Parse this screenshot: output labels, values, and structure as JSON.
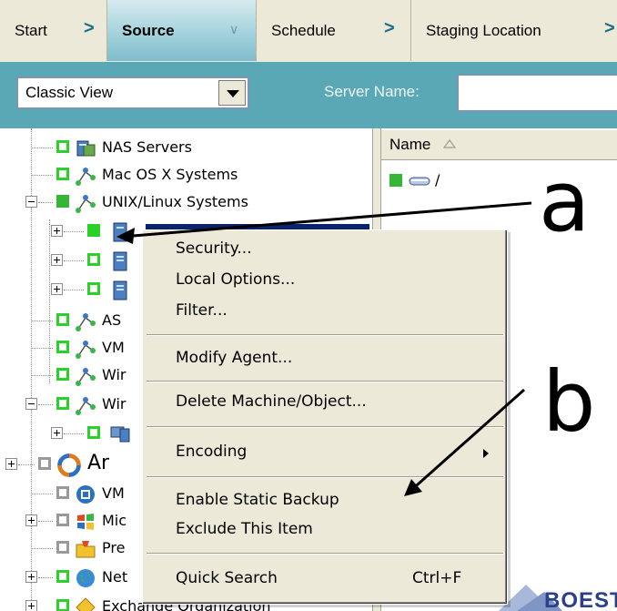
{
  "wizard_tabs": [
    {
      "label": "Start"
    },
    {
      "label": "Source"
    },
    {
      "label": "Schedule"
    },
    {
      "label": "Staging Location"
    }
  ],
  "view_select": {
    "value": "Classic View"
  },
  "server_name": {
    "label": "Server Name:",
    "value": ""
  },
  "tree": {
    "items": [
      {
        "label": "NAS Servers",
        "icon": "nas-server-icon"
      },
      {
        "label": "Mac OS X Systems",
        "icon": "network-icon"
      },
      {
        "label": "UNIX/Linux Systems",
        "icon": "network-icon"
      },
      {
        "label": "",
        "icon": "server-icon"
      },
      {
        "label": "",
        "icon": "server-icon"
      },
      {
        "label": "",
        "icon": "server-icon"
      },
      {
        "label": "AS",
        "icon": "network-icon"
      },
      {
        "label": "VM",
        "icon": "network-icon"
      },
      {
        "label": "Wir",
        "icon": "network-icon"
      },
      {
        "label": "Wir",
        "icon": "network-icon"
      },
      {
        "label": "",
        "icon": "computer-icon"
      },
      {
        "label": "Ar",
        "icon": "sync-icon"
      },
      {
        "label": "VM",
        "icon": "vm-icon"
      },
      {
        "label": "Mic",
        "icon": "microsoft-icon"
      },
      {
        "label": "Pre",
        "icon": "folder-icon"
      },
      {
        "label": "Net",
        "icon": "globe-icon"
      },
      {
        "label": "Exchange Organization",
        "icon": "exchange-icon"
      }
    ]
  },
  "file_list": {
    "column_header": "Name",
    "items": [
      {
        "label": "/"
      }
    ]
  },
  "banner": {
    "text": "BOESTO"
  },
  "context_menu": {
    "items": [
      {
        "label": "Security..."
      },
      {
        "label": "Local Options..."
      },
      {
        "label": "Filter..."
      },
      {
        "label": "Modify Agent..."
      },
      {
        "label": "Delete Machine/Object..."
      },
      {
        "label": "Encoding"
      },
      {
        "label": "Enable Static Backup"
      },
      {
        "label": "Exclude This Item"
      },
      {
        "label": "Quick Search",
        "shortcut": "Ctrl+F"
      }
    ]
  },
  "annotations": {
    "a": "a",
    "b": "b"
  },
  "colors": {
    "accent": "#5aa7b5",
    "selection": "#0a246a",
    "checkbox_green": "#2bd12b"
  }
}
